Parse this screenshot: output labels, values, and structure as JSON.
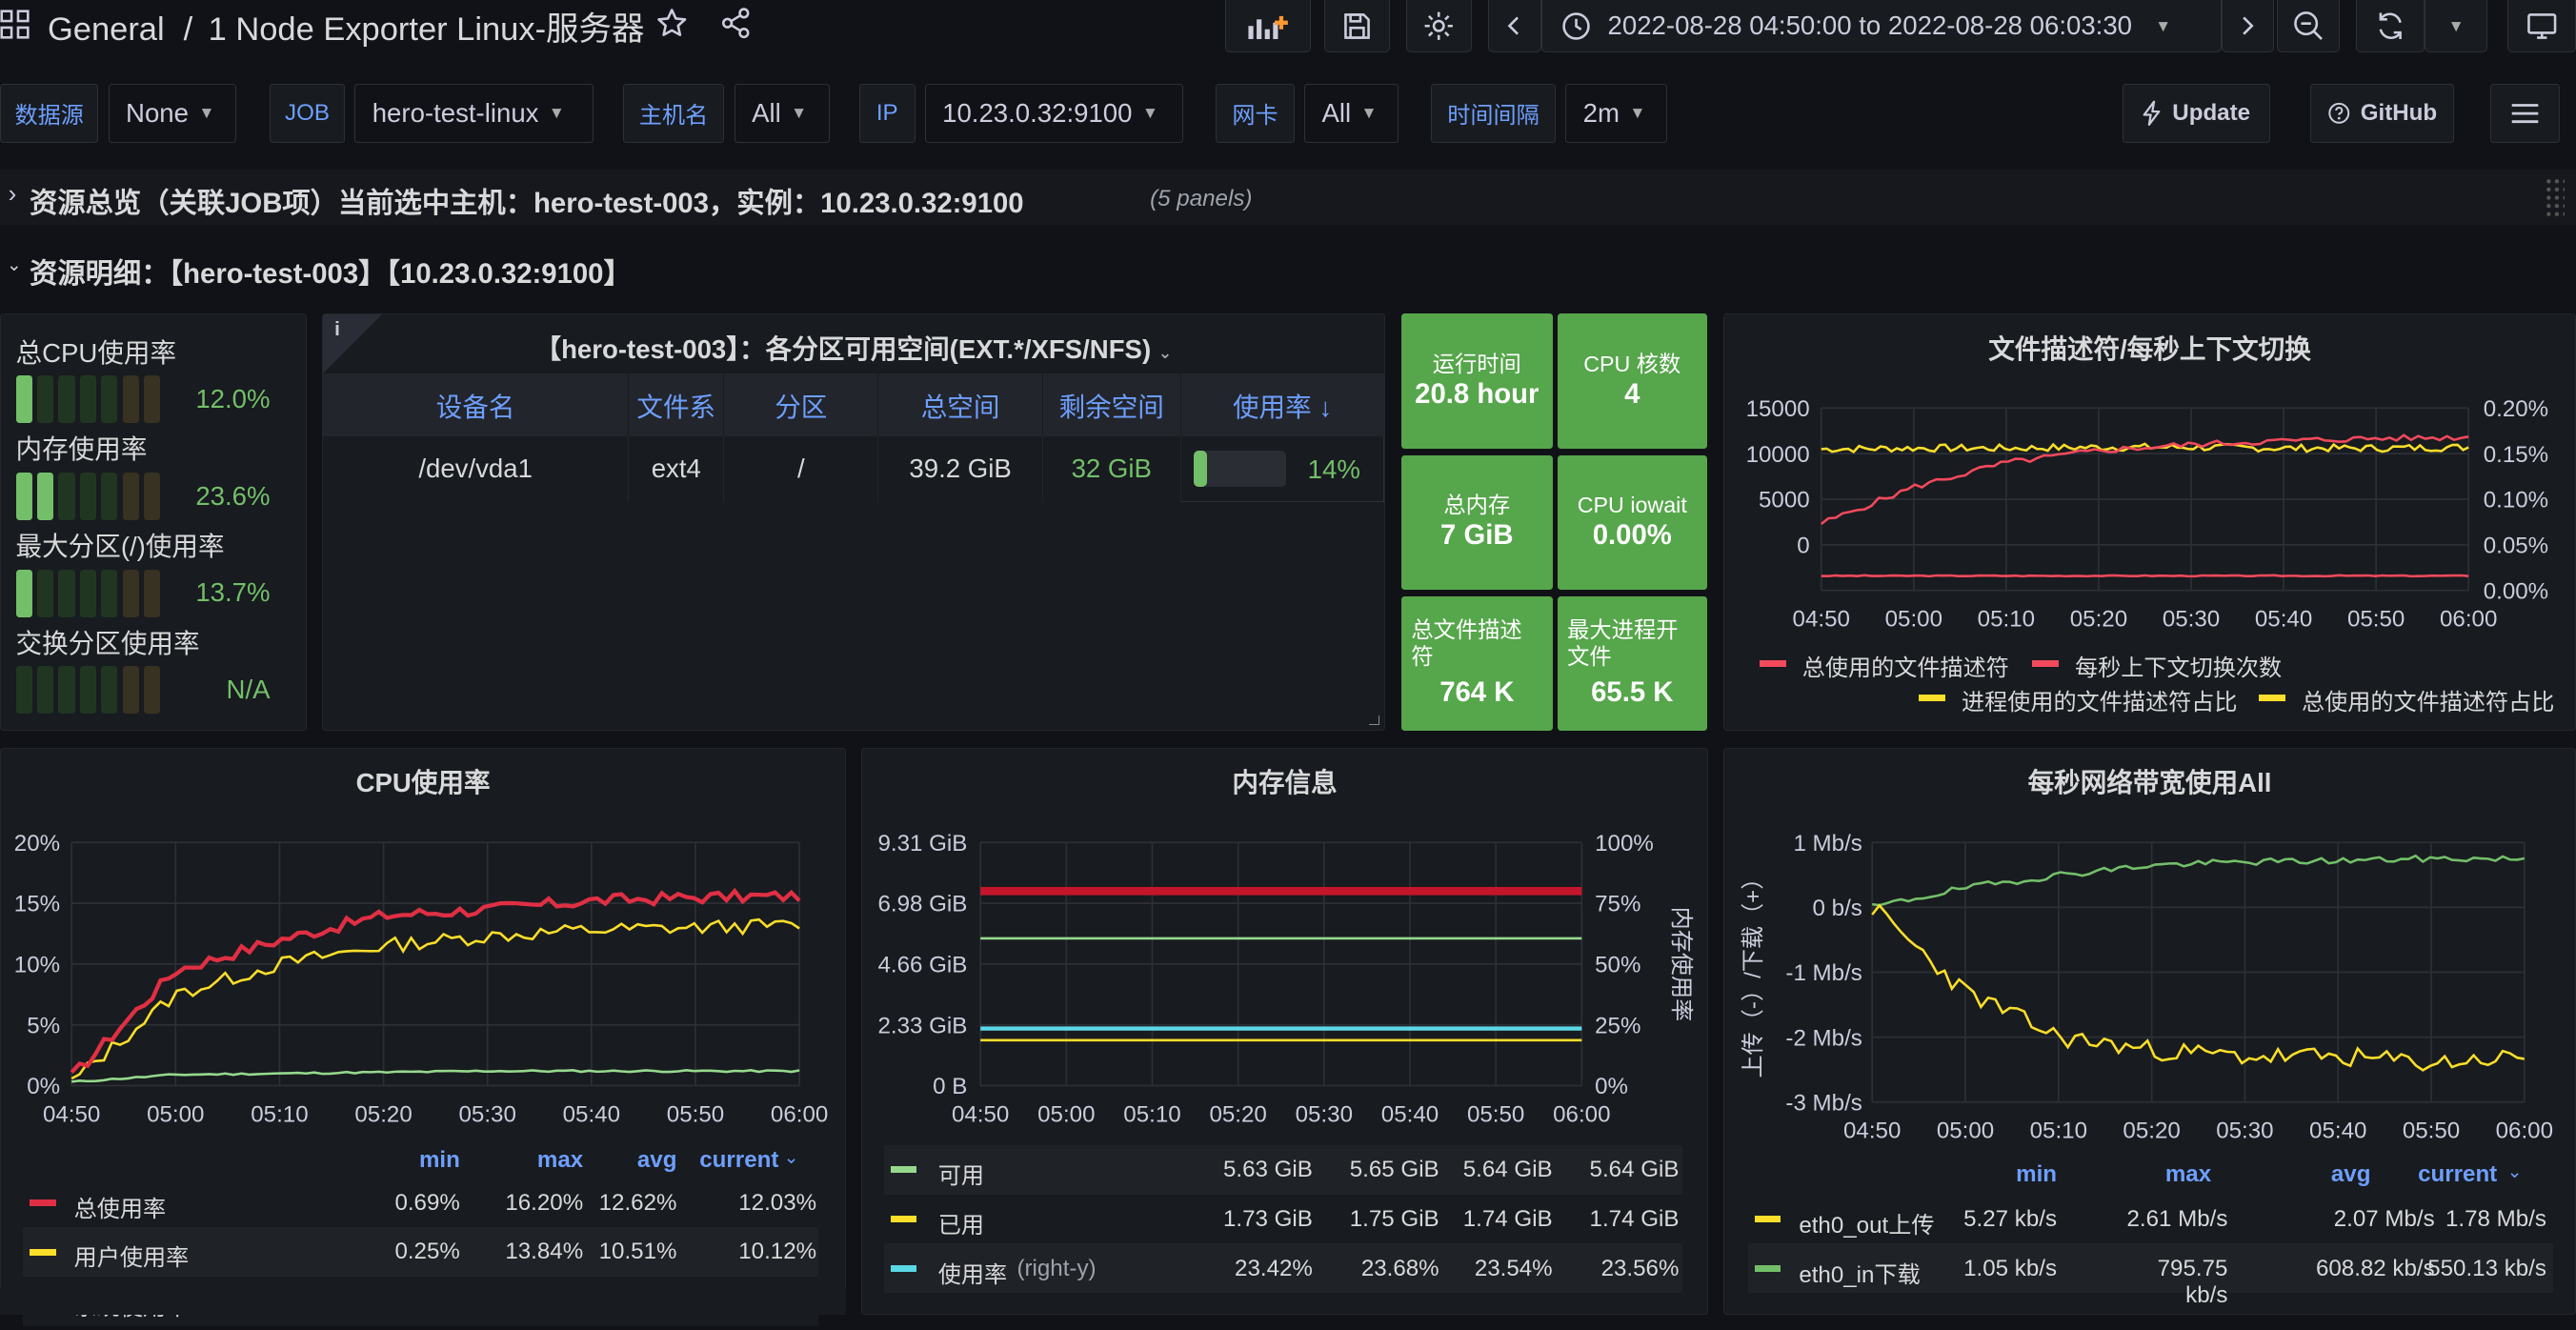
{
  "nav": {
    "home": "General",
    "sep": "/",
    "dashboard": "1 Node Exporter Linux-服务器",
    "time_range": "2022-08-28 04:50:00 to 2022-08-28 06:03:30"
  },
  "vars": [
    {
      "label": "数据源",
      "value": "None"
    },
    {
      "label": "JOB",
      "value": "hero-test-linux"
    },
    {
      "label": "主机名",
      "value": "All"
    },
    {
      "label": "IP",
      "value": "10.23.0.32:9100"
    },
    {
      "label": "网卡",
      "value": "All"
    },
    {
      "label": "时间间隔",
      "value": "2m"
    }
  ],
  "buttons": {
    "update": "Update",
    "github": "GitHub"
  },
  "rows": {
    "overview": "资源总览（关联JOB项）当前选中主机：hero-test-003，实例：10.23.0.32:9100",
    "overview_count": "(5 panels)",
    "detail": "资源明细：【hero-test-003】【10.23.0.32:9100】"
  },
  "gauges": [
    {
      "label": "总CPU使用率",
      "value": "12.0%",
      "level": 0.12,
      "color": "#73bf69"
    },
    {
      "label": "内存使用率",
      "value": "23.6%",
      "level": 0.236,
      "color": "#73bf69"
    },
    {
      "label": "最大分区(/)使用率",
      "value": "13.7%",
      "level": 0.137,
      "color": "#73bf69"
    },
    {
      "label": "交换分区使用率",
      "value": "N/A",
      "level": 0,
      "color": "#73bf69"
    }
  ],
  "disk": {
    "title": "【hero-test-003】：各分区可用空间(EXT.*/XFS/NFS)",
    "headers": [
      "设备名",
      "文件系",
      "分区",
      "总空间",
      "剩余空间",
      "使用率"
    ],
    "row": {
      "device": "/dev/vda1",
      "fs": "ext4",
      "mount": "/",
      "total": "39.2 GiB",
      "free": "32 GiB",
      "usage": "14%",
      "usage_level": 0.14
    }
  },
  "stats": [
    {
      "title": "运行时间",
      "value": "20.8 hour"
    },
    {
      "title": "CPU 核数",
      "value": "4"
    },
    {
      "title": "总内存",
      "value": "7 GiB"
    },
    {
      "title": "CPU iowait",
      "value": "0.00%"
    },
    {
      "title": "总文件描述符",
      "value": "764 K"
    },
    {
      "title": "最大进程开文件",
      "value": "65.5 K"
    }
  ],
  "legend_headers": {
    "min": "min",
    "max": "max",
    "avg": "avg",
    "current": "current"
  },
  "chart_data": [
    {
      "type": "line",
      "title": "文件描述符/每秒上下文切换",
      "x": [
        "04:50",
        "05:00",
        "05:10",
        "05:20",
        "05:30",
        "05:40",
        "05:50",
        "06:00"
      ],
      "ylim": [
        0,
        15000
      ],
      "y_ticks": [
        "15000",
        "10000",
        "5000",
        "0"
      ],
      "y2_ticks": [
        "0.20%",
        "0.15%",
        "0.10%",
        "0.05%",
        "0.00%"
      ],
      "series": [
        {
          "name": "总使用的文件描述符",
          "color": "#f2495c",
          "values": [
            1200,
            1200,
            1200,
            1200,
            1200,
            1200,
            1200,
            1200
          ]
        },
        {
          "name": "每秒上下文切换次数",
          "color": "#f2495c",
          "values": [
            5500,
            8500,
            10500,
            11500,
            12000,
            12300,
            12500,
            12600
          ]
        },
        {
          "name": "进程使用的文件描述符占比",
          "color": "#fade2a",
          "values": [
            0.155,
            0.156,
            0.156,
            0.157,
            0.157,
            0.156,
            0.156,
            0.157
          ]
        },
        {
          "name": "总使用的文件描述符占比",
          "color": "#fade2a",
          "values": [
            0.155,
            0.156,
            0.156,
            0.157,
            0.157,
            0.156,
            0.156,
            0.157
          ]
        }
      ]
    },
    {
      "type": "line",
      "title": "CPU使用率",
      "x": [
        "04:50",
        "05:00",
        "05:10",
        "05:20",
        "05:30",
        "05:40",
        "05:50",
        "06:00"
      ],
      "ylim": [
        0,
        20
      ],
      "y_ticks": [
        "20%",
        "15%",
        "10%",
        "5%",
        "0%"
      ],
      "series": [
        {
          "name": "总使用率",
          "color": "#e02f44",
          "min": "0.69%",
          "max": "16.20%",
          "avg": "12.62%",
          "current": "12.03%",
          "values": [
            0.7,
            9.5,
            12.0,
            14.0,
            14.5,
            15.2,
            15.5,
            15.6
          ]
        },
        {
          "name": "用户使用率",
          "color": "#fade2a",
          "min": "0.25%",
          "max": "13.84%",
          "avg": "10.51%",
          "current": "10.12%",
          "values": [
            0.3,
            7.5,
            10.0,
            11.5,
            12.3,
            12.8,
            13.0,
            13.2
          ]
        },
        {
          "name": "系统使用率",
          "color": "#96d98d",
          "values": [
            0.3,
            0.9,
            1.0,
            1.1,
            1.2,
            1.2,
            1.2,
            1.2
          ]
        }
      ]
    },
    {
      "type": "line",
      "title": "内存信息",
      "x": [
        "04:50",
        "05:00",
        "05:10",
        "05:20",
        "05:30",
        "05:40",
        "05:50",
        "06:00"
      ],
      "y_ticks": [
        "9.31 GiB",
        "6.98 GiB",
        "4.66 GiB",
        "2.33 GiB",
        "0 B"
      ],
      "y2_ticks": [
        "100%",
        "75%",
        "50%",
        "25%",
        "0%"
      ],
      "y2_label": "内存使用率",
      "series": [
        {
          "name": "可用",
          "color": "#96d98d",
          "min": "5.63 GiB",
          "max": "5.65 GiB",
          "avg": "5.64 GiB",
          "current": "5.64 GiB",
          "values": [
            5.64,
            5.64,
            5.64,
            5.64,
            5.64,
            5.64,
            5.64,
            5.64
          ]
        },
        {
          "name": "已用",
          "color": "#fade2a",
          "min": "1.73 GiB",
          "max": "1.75 GiB",
          "avg": "1.74 GiB",
          "current": "1.74 GiB",
          "values": [
            1.74,
            1.74,
            1.74,
            1.74,
            1.74,
            1.74,
            1.74,
            1.74
          ]
        },
        {
          "name": "使用率",
          "suffix": "(right-y)",
          "color": "#5ad8e6",
          "min": "23.42%",
          "max": "23.68%",
          "avg": "23.54%",
          "current": "23.56%",
          "values": [
            23.5,
            23.5,
            23.5,
            23.5,
            23.5,
            23.5,
            23.5,
            23.5
          ]
        }
      ]
    },
    {
      "type": "line",
      "title": "每秒网络带宽使用All",
      "x": [
        "04:50",
        "05:00",
        "05:10",
        "05:20",
        "05:30",
        "05:40",
        "05:50",
        "06:00"
      ],
      "ylim": [
        -3,
        1
      ],
      "y_ticks": [
        "1 Mb/s",
        "0 b/s",
        "-1 Mb/s",
        "-2 Mb/s",
        "-3 Mb/s"
      ],
      "ylabel": "上传（-）/下载（+）",
      "series": [
        {
          "name": "eth0_out上传",
          "color": "#fade2a",
          "min": "5.27 kb/s",
          "max": "2.61 Mb/s",
          "avg": "2.07 Mb/s",
          "current": "1.78 Mb/s",
          "values": [
            0,
            -1.3,
            -2.0,
            -2.2,
            -2.3,
            -2.3,
            -2.4,
            -2.3
          ]
        },
        {
          "name": "eth0_in下载",
          "color": "#73bf69",
          "min": "1.05 kb/s",
          "max": "795.75 kb/s",
          "avg": "608.82 kb/s",
          "current": "550.13 kb/s",
          "values": [
            0,
            0.3,
            0.5,
            0.65,
            0.7,
            0.72,
            0.75,
            0.75
          ]
        }
      ]
    }
  ]
}
